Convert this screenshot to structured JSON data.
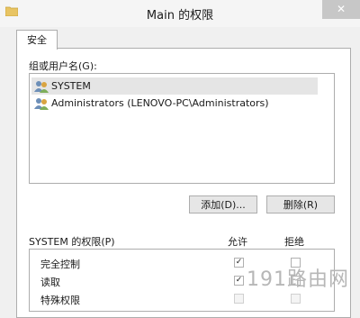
{
  "window": {
    "title": "Main 的权限"
  },
  "tabs": [
    {
      "label": "安全"
    }
  ],
  "groups": {
    "label": "组或用户名(G):",
    "users": [
      {
        "name": "SYSTEM",
        "selected": true
      },
      {
        "name": "Administrators (LENOVO-PC\\Administrators)",
        "selected": false
      }
    ]
  },
  "buttons": {
    "add": "添加(D)...",
    "remove": "删除(R)"
  },
  "permissions": {
    "title": "SYSTEM 的权限(P)",
    "allow_header": "允许",
    "deny_header": "拒绝",
    "rows": [
      {
        "label": "完全控制",
        "allow": true,
        "deny": false
      },
      {
        "label": "读取",
        "allow": true,
        "deny": false
      },
      {
        "label": "特殊权限",
        "allow": false,
        "deny": false
      }
    ]
  },
  "watermark": "191路由网",
  "icons": {
    "folder": "folder-icon",
    "user": "user-group-icon",
    "close": "close-icon"
  }
}
